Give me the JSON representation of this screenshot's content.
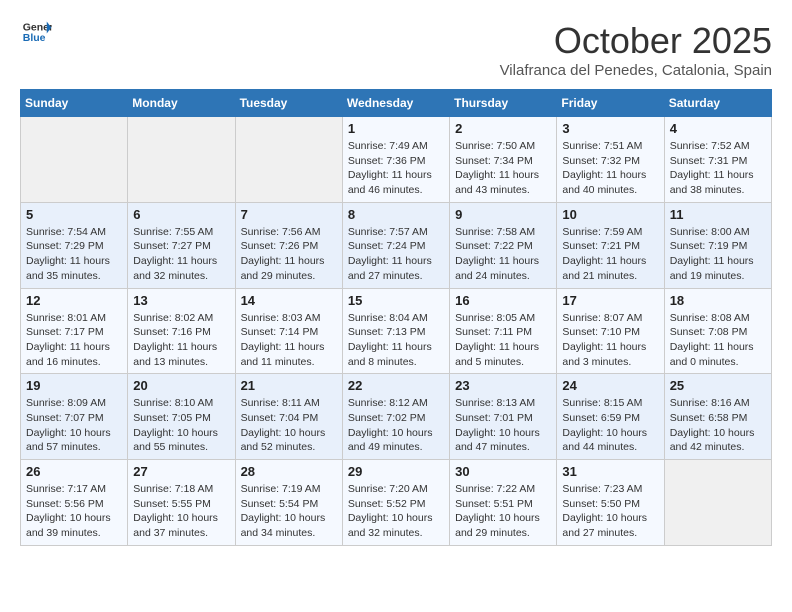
{
  "header": {
    "logo_line1": "General",
    "logo_line2": "Blue",
    "month": "October 2025",
    "location": "Vilafranca del Penedes, Catalonia, Spain"
  },
  "weekdays": [
    "Sunday",
    "Monday",
    "Tuesday",
    "Wednesday",
    "Thursday",
    "Friday",
    "Saturday"
  ],
  "weeks": [
    [
      {
        "day": "",
        "info": ""
      },
      {
        "day": "",
        "info": ""
      },
      {
        "day": "",
        "info": ""
      },
      {
        "day": "1",
        "info": "Sunrise: 7:49 AM\nSunset: 7:36 PM\nDaylight: 11 hours\nand 46 minutes."
      },
      {
        "day": "2",
        "info": "Sunrise: 7:50 AM\nSunset: 7:34 PM\nDaylight: 11 hours\nand 43 minutes."
      },
      {
        "day": "3",
        "info": "Sunrise: 7:51 AM\nSunset: 7:32 PM\nDaylight: 11 hours\nand 40 minutes."
      },
      {
        "day": "4",
        "info": "Sunrise: 7:52 AM\nSunset: 7:31 PM\nDaylight: 11 hours\nand 38 minutes."
      }
    ],
    [
      {
        "day": "5",
        "info": "Sunrise: 7:54 AM\nSunset: 7:29 PM\nDaylight: 11 hours\nand 35 minutes."
      },
      {
        "day": "6",
        "info": "Sunrise: 7:55 AM\nSunset: 7:27 PM\nDaylight: 11 hours\nand 32 minutes."
      },
      {
        "day": "7",
        "info": "Sunrise: 7:56 AM\nSunset: 7:26 PM\nDaylight: 11 hours\nand 29 minutes."
      },
      {
        "day": "8",
        "info": "Sunrise: 7:57 AM\nSunset: 7:24 PM\nDaylight: 11 hours\nand 27 minutes."
      },
      {
        "day": "9",
        "info": "Sunrise: 7:58 AM\nSunset: 7:22 PM\nDaylight: 11 hours\nand 24 minutes."
      },
      {
        "day": "10",
        "info": "Sunrise: 7:59 AM\nSunset: 7:21 PM\nDaylight: 11 hours\nand 21 minutes."
      },
      {
        "day": "11",
        "info": "Sunrise: 8:00 AM\nSunset: 7:19 PM\nDaylight: 11 hours\nand 19 minutes."
      }
    ],
    [
      {
        "day": "12",
        "info": "Sunrise: 8:01 AM\nSunset: 7:17 PM\nDaylight: 11 hours\nand 16 minutes."
      },
      {
        "day": "13",
        "info": "Sunrise: 8:02 AM\nSunset: 7:16 PM\nDaylight: 11 hours\nand 13 minutes."
      },
      {
        "day": "14",
        "info": "Sunrise: 8:03 AM\nSunset: 7:14 PM\nDaylight: 11 hours\nand 11 minutes."
      },
      {
        "day": "15",
        "info": "Sunrise: 8:04 AM\nSunset: 7:13 PM\nDaylight: 11 hours\nand 8 minutes."
      },
      {
        "day": "16",
        "info": "Sunrise: 8:05 AM\nSunset: 7:11 PM\nDaylight: 11 hours\nand 5 minutes."
      },
      {
        "day": "17",
        "info": "Sunrise: 8:07 AM\nSunset: 7:10 PM\nDaylight: 11 hours\nand 3 minutes."
      },
      {
        "day": "18",
        "info": "Sunrise: 8:08 AM\nSunset: 7:08 PM\nDaylight: 11 hours\nand 0 minutes."
      }
    ],
    [
      {
        "day": "19",
        "info": "Sunrise: 8:09 AM\nSunset: 7:07 PM\nDaylight: 10 hours\nand 57 minutes."
      },
      {
        "day": "20",
        "info": "Sunrise: 8:10 AM\nSunset: 7:05 PM\nDaylight: 10 hours\nand 55 minutes."
      },
      {
        "day": "21",
        "info": "Sunrise: 8:11 AM\nSunset: 7:04 PM\nDaylight: 10 hours\nand 52 minutes."
      },
      {
        "day": "22",
        "info": "Sunrise: 8:12 AM\nSunset: 7:02 PM\nDaylight: 10 hours\nand 49 minutes."
      },
      {
        "day": "23",
        "info": "Sunrise: 8:13 AM\nSunset: 7:01 PM\nDaylight: 10 hours\nand 47 minutes."
      },
      {
        "day": "24",
        "info": "Sunrise: 8:15 AM\nSunset: 6:59 PM\nDaylight: 10 hours\nand 44 minutes."
      },
      {
        "day": "25",
        "info": "Sunrise: 8:16 AM\nSunset: 6:58 PM\nDaylight: 10 hours\nand 42 minutes."
      }
    ],
    [
      {
        "day": "26",
        "info": "Sunrise: 7:17 AM\nSunset: 5:56 PM\nDaylight: 10 hours\nand 39 minutes."
      },
      {
        "day": "27",
        "info": "Sunrise: 7:18 AM\nSunset: 5:55 PM\nDaylight: 10 hours\nand 37 minutes."
      },
      {
        "day": "28",
        "info": "Sunrise: 7:19 AM\nSunset: 5:54 PM\nDaylight: 10 hours\nand 34 minutes."
      },
      {
        "day": "29",
        "info": "Sunrise: 7:20 AM\nSunset: 5:52 PM\nDaylight: 10 hours\nand 32 minutes."
      },
      {
        "day": "30",
        "info": "Sunrise: 7:22 AM\nSunset: 5:51 PM\nDaylight: 10 hours\nand 29 minutes."
      },
      {
        "day": "31",
        "info": "Sunrise: 7:23 AM\nSunset: 5:50 PM\nDaylight: 10 hours\nand 27 minutes."
      },
      {
        "day": "",
        "info": ""
      }
    ]
  ]
}
